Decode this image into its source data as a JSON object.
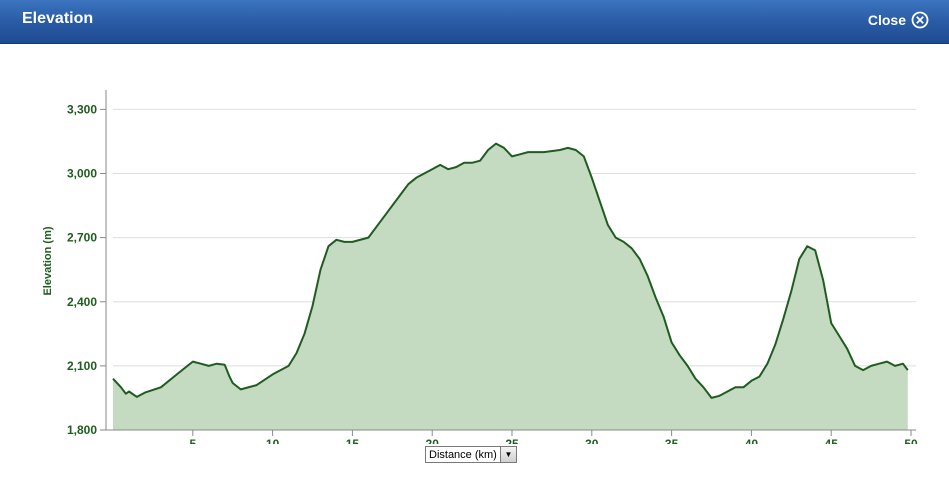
{
  "window": {
    "title": "Elevation",
    "close_label": "Close"
  },
  "colors": {
    "line": "#1f5c1f",
    "fill": "#c4dbc1",
    "grid": "#dedede",
    "axis": "#8a8a8a",
    "header": "#2a5ca6"
  },
  "icons": {
    "close": "close-circle-x-icon",
    "dropdown": "triangle-down-icon"
  },
  "x_axis_selector": {
    "value": "Distance (km)"
  },
  "chart_data": {
    "type": "area",
    "xlabel": "Distance (km)",
    "ylabel": "Elevation (m)",
    "xlim": [
      0,
      50
    ],
    "ylim": [
      1800,
      3400
    ],
    "grid": true,
    "x_ticks": [
      5,
      10,
      15,
      20,
      25,
      30,
      35,
      40,
      45,
      50
    ],
    "y_ticks": [
      1800,
      2100,
      2400,
      2700,
      3000,
      3300
    ],
    "x_tick_labels": [
      "5",
      "10",
      "15",
      "20",
      "25",
      "30",
      "35",
      "40",
      "45",
      "50"
    ],
    "y_tick_labels": [
      "1,800",
      "2,100",
      "2,400",
      "2,700",
      "3,000",
      "3,300"
    ],
    "x": [
      0,
      0.5,
      0.8,
      1,
      1.5,
      2,
      3,
      4,
      5,
      5.5,
      6,
      6.5,
      7,
      7.3,
      7.5,
      8,
      9,
      10,
      11,
      11.5,
      12,
      12.5,
      13,
      13.5,
      14,
      14.5,
      15,
      16,
      17,
      18,
      18.5,
      19,
      19.5,
      20,
      20.5,
      21,
      21.5,
      22,
      22.5,
      23,
      23.5,
      24,
      24.5,
      25,
      25.5,
      26,
      27,
      28,
      28.5,
      29,
      29.5,
      30,
      30.5,
      31,
      31.5,
      32,
      32.5,
      33,
      33.5,
      34,
      34.5,
      35,
      35.5,
      36,
      36.5,
      37,
      37.5,
      38,
      38.5,
      39,
      39.5,
      40,
      40.5,
      41,
      41.5,
      42,
      42.5,
      43,
      43.5,
      44,
      44.5,
      45,
      45.5,
      46,
      46.5,
      47,
      47.5,
      48,
      48.5,
      49,
      49.5,
      49.8
    ],
    "y": [
      2040,
      2000,
      1970,
      1980,
      1955,
      1975,
      2000,
      2060,
      2120,
      2110,
      2100,
      2110,
      2105,
      2050,
      2020,
      1990,
      2010,
      2060,
      2100,
      2160,
      2250,
      2380,
      2550,
      2660,
      2690,
      2680,
      2680,
      2700,
      2800,
      2900,
      2950,
      2980,
      3000,
      3020,
      3040,
      3020,
      3030,
      3050,
      3050,
      3060,
      3110,
      3140,
      3120,
      3080,
      3090,
      3100,
      3100,
      3110,
      3120,
      3110,
      3080,
      2980,
      2870,
      2760,
      2700,
      2680,
      2650,
      2600,
      2520,
      2420,
      2330,
      2210,
      2150,
      2100,
      2040,
      2000,
      1950,
      1960,
      1980,
      2000,
      2000,
      2030,
      2050,
      2110,
      2200,
      2320,
      2450,
      2600,
      2660,
      2640,
      2500,
      2300,
      2240,
      2180,
      2100,
      2080,
      2100,
      2110,
      2120,
      2100,
      2110,
      2080,
      2040
    ]
  }
}
